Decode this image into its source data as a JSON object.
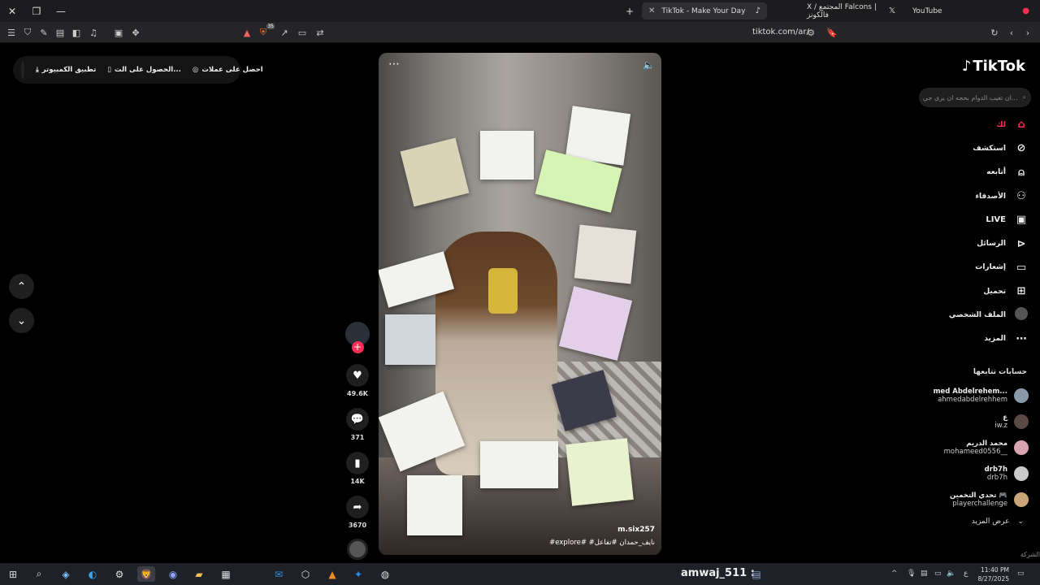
{
  "browser": {
    "tabs": [
      {
        "title": "TikTok - Make Your Day",
        "active": true
      },
      {
        "title": "X / المجتمع Falcons | فالكونز",
        "active": false
      },
      {
        "title": "YouTube",
        "active": false
      }
    ],
    "url": "tiktok.com/ar/",
    "shield_badge": "35"
  },
  "topbar": {
    "get_coins": "احصل على عملات",
    "get_app": "الحصول على الت...",
    "desktop_app": "تطبيق الكمبيوتر"
  },
  "video": {
    "author": "m.six257",
    "caption": "#explore# #نايف_حمدان #تفاعل"
  },
  "actions": {
    "likes": "49.6K",
    "comments": "371",
    "saves": "14K",
    "shares": "3670",
    "plus": "+"
  },
  "sidebar": {
    "logo": "TikTok",
    "search_placeholder": "ان تغيب الدوام بحجه ان يرى جي...",
    "nav": [
      {
        "label": "لك",
        "icon": "home-icon",
        "active": true
      },
      {
        "label": "استكشف",
        "icon": "compass-icon"
      },
      {
        "label": "أتابعه",
        "icon": "user-follow-icon"
      },
      {
        "label": "الأصدقاء",
        "icon": "friends-icon"
      },
      {
        "label": "LIVE",
        "icon": "live-icon"
      },
      {
        "label": "الرسائل",
        "icon": "send-icon"
      },
      {
        "label": "إشعارات",
        "icon": "inbox-icon"
      },
      {
        "label": "تحميل",
        "icon": "upload-icon"
      },
      {
        "label": "الملف الشخصي",
        "icon": "profile-avatar-icon"
      },
      {
        "label": "المزيد",
        "icon": "more-icon"
      }
    ],
    "following_heading": "حسابات تتابعها",
    "following": [
      {
        "name": "med Abdelrehem...",
        "handle": "ahmedabdelrehhem"
      },
      {
        "name": "ع",
        "handle": "iw.z"
      },
      {
        "name": "محمد الدريم",
        "handle": "mohameed0556__"
      },
      {
        "name": "drb7h",
        "handle": "drb7h"
      },
      {
        "name": "تحدي التخمين 🎮",
        "handle": "playerchallenge"
      }
    ],
    "see_more": "عرض المزيد",
    "company": "الشركة"
  },
  "taskbar": {
    "overlay_user": "amwaj_511 :",
    "lang": "ع",
    "time": "11:40 PM",
    "date": "8/27/2025"
  },
  "colors": {
    "accent": "#fe2c55",
    "background": "#000000"
  }
}
